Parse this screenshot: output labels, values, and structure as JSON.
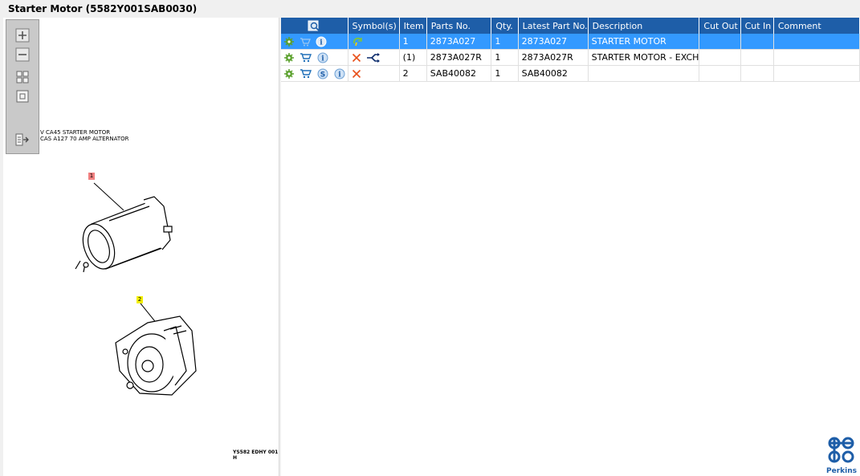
{
  "window": {
    "title": "Starter Motor (5582Y001SAB0030)"
  },
  "drawing": {
    "label_line1": "V CA45 STARTER MOTOR",
    "label_line2": "CAS A127 70 AMP ALTERNATOR",
    "callouts": [
      "1",
      "2"
    ],
    "footer_code": "YS582 EDHY 001 H"
  },
  "toolbar": {
    "items": [
      {
        "icon": "zoom-in-icon"
      },
      {
        "icon": "zoom-out-icon"
      },
      {
        "icon": "fit-all-icon"
      },
      {
        "icon": "fit-window-icon"
      },
      {
        "icon": "export-icon"
      }
    ]
  },
  "table": {
    "headers": [
      "",
      "Symbol(s)",
      "Item",
      "Parts No.",
      "Qty.",
      "Latest Part No.",
      "Description",
      "Cut Out",
      "Cut In",
      "Comment"
    ],
    "rows": [
      {
        "item": "1",
        "parts_no": "2873A027",
        "qty": "1",
        "latest_part_no": "2873A027",
        "description": "STARTER MOTOR",
        "cut_out": "",
        "cut_in": "",
        "comment": "",
        "selected": true,
        "actions": [
          "gear-icon",
          "cart-icon",
          "info-icon"
        ],
        "symbols": [
          "recycle-icon"
        ]
      },
      {
        "item": "(1)",
        "parts_no": "2873A027R",
        "qty": "1",
        "latest_part_no": "2873A027R",
        "description": "STARTER MOTOR - EXCH",
        "cut_out": "",
        "cut_in": "",
        "comment": "",
        "selected": false,
        "actions": [
          "gear-icon",
          "cart-icon",
          "info-icon"
        ],
        "symbols": [
          "cross-icon",
          "split-arrow-icon"
        ]
      },
      {
        "item": "2",
        "parts_no": "SAB40082",
        "qty": "1",
        "latest_part_no": "SAB40082",
        "description": "",
        "cut_out": "",
        "cut_in": "",
        "comment": "",
        "selected": false,
        "actions": [
          "gear-icon",
          "cart-icon",
          "s-badge-icon",
          "info-icon"
        ],
        "symbols": [
          "cross-icon"
        ]
      }
    ]
  },
  "brand": {
    "name": "Perkins",
    "color": "#1e5ea8"
  },
  "colors": {
    "header": "#1e5ea8",
    "selection": "#3399ff",
    "accent_green": "#5aa02c",
    "cross": "#e8501a"
  }
}
